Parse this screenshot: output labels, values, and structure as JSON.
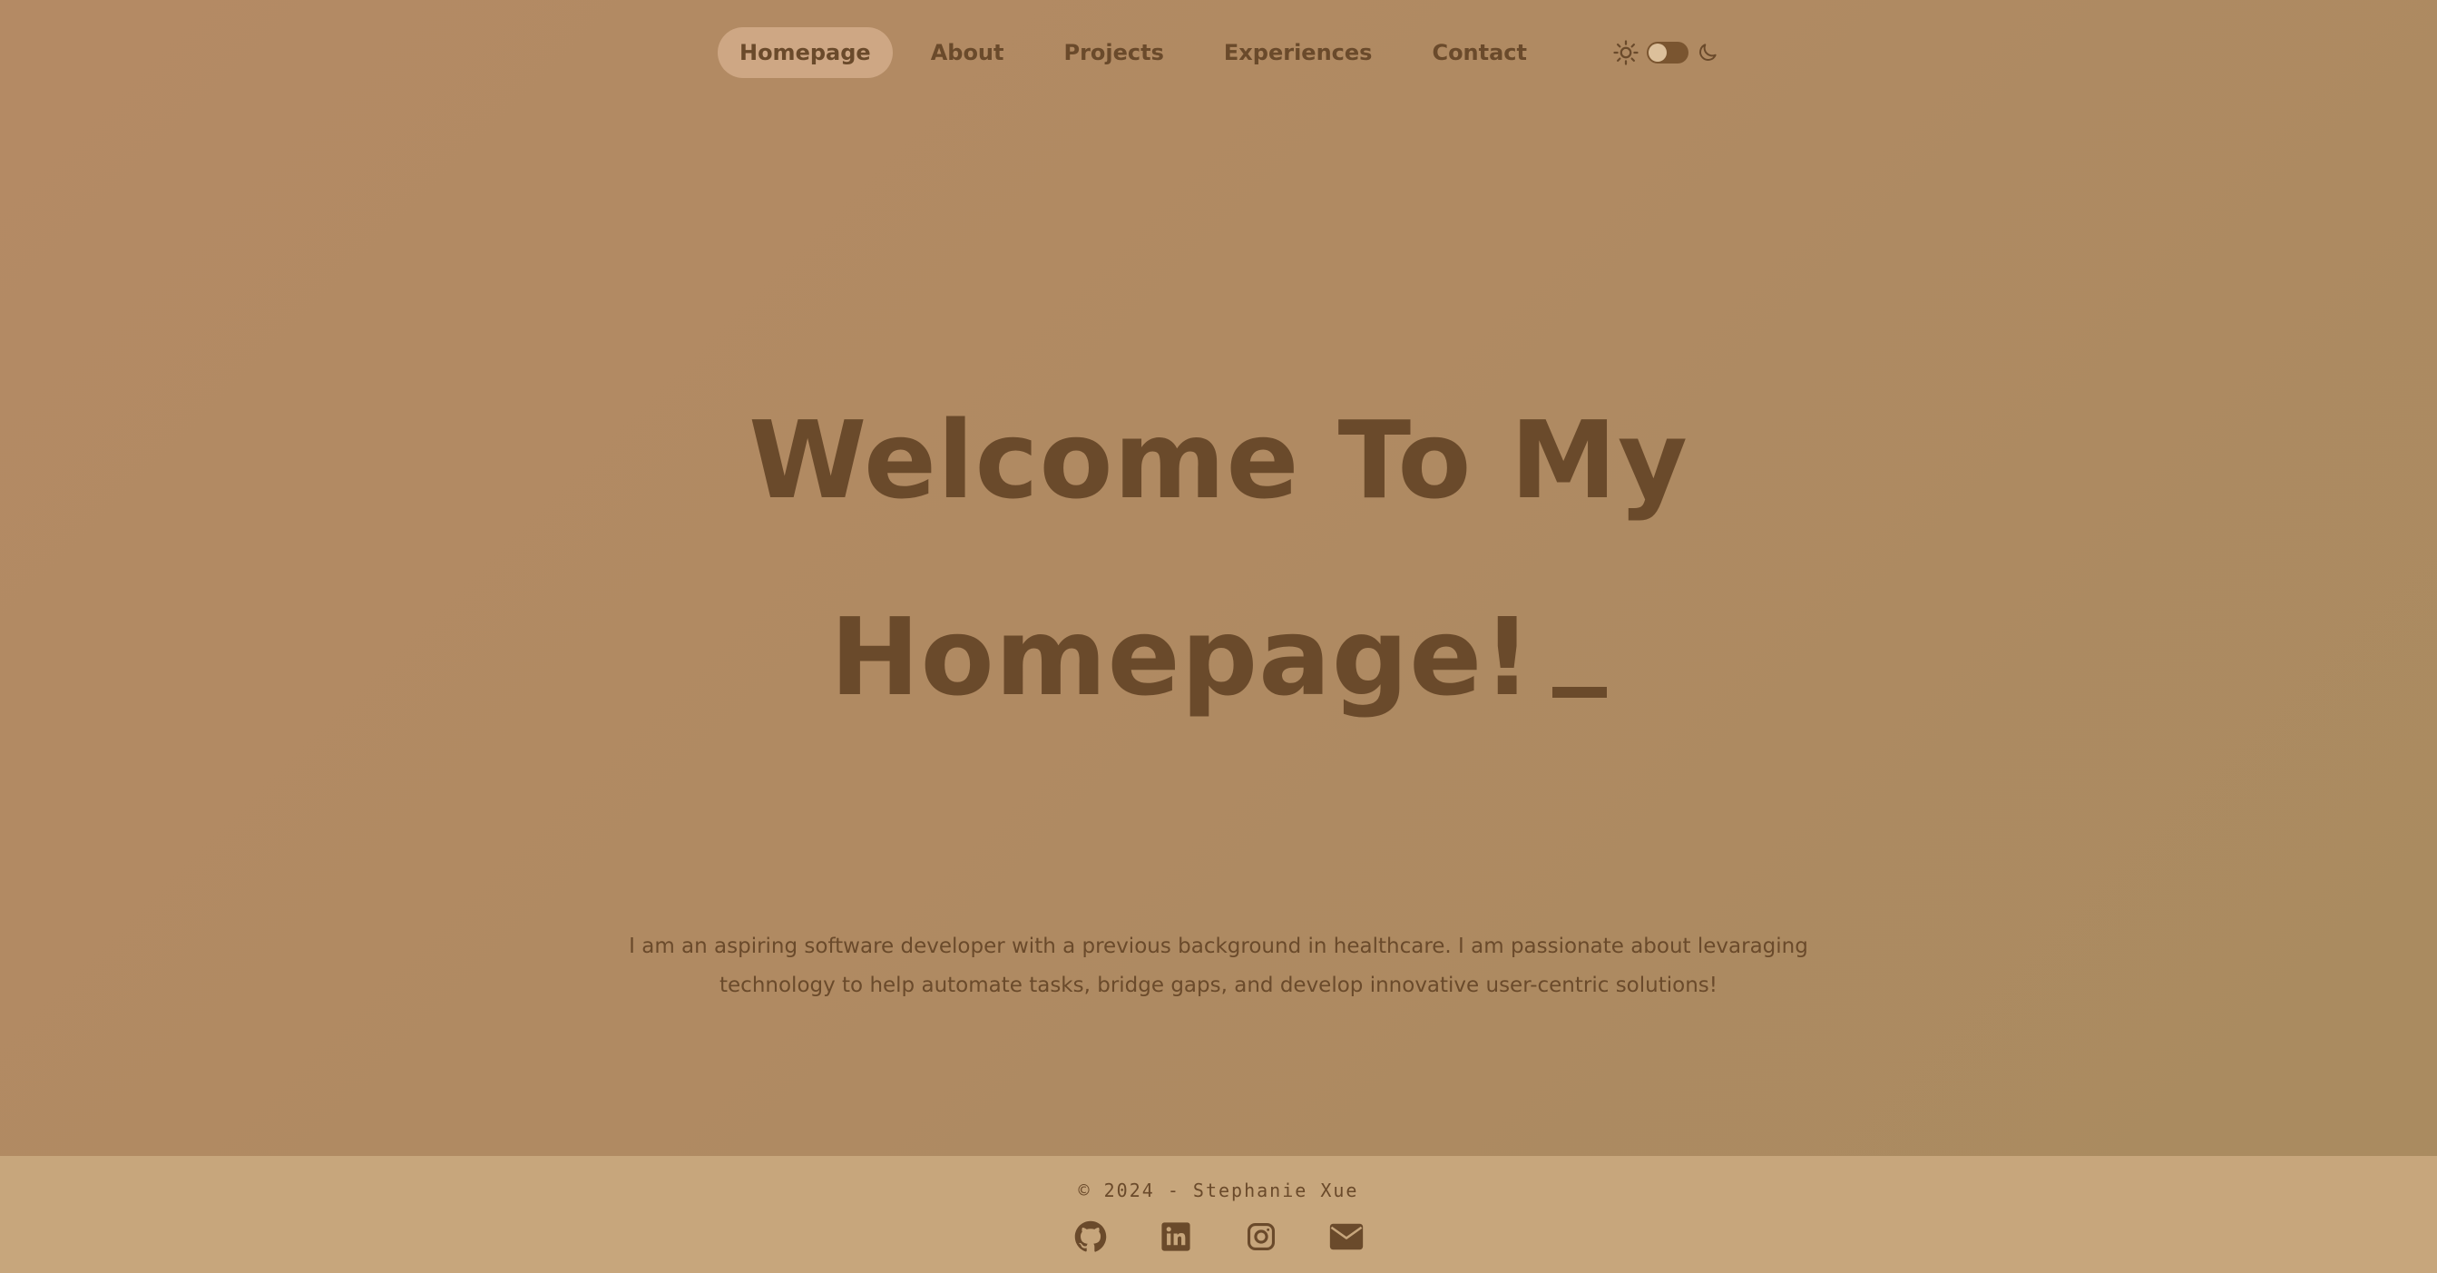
{
  "nav": {
    "items": [
      {
        "label": "Homepage",
        "active": true
      },
      {
        "label": "About",
        "active": false
      },
      {
        "label": "Projects",
        "active": false
      },
      {
        "label": "Experiences",
        "active": false
      },
      {
        "label": "Contact",
        "active": false
      }
    ],
    "theme_toggle": {
      "left_icon": "sun-icon",
      "right_icon": "moon-icon",
      "state": "light"
    }
  },
  "hero": {
    "line1": "Welcome To My",
    "line2": "Homepage!"
  },
  "intro": {
    "text": "I am an aspiring software developer with a previous background in healthcare. I am passionate about levaraging technology to help automate tasks, bridge gaps, and develop innovative user-centric solutions!"
  },
  "footer": {
    "copyright": "© 2024 - Stephanie Xue",
    "social": [
      "github-icon",
      "linkedin-icon",
      "instagram-icon",
      "email-icon"
    ]
  },
  "colors": {
    "background": "#b08a62",
    "text": "#6a4a2b",
    "nav_active_bg": "#d7b08f",
    "footer_bg": "#c7a67c"
  }
}
